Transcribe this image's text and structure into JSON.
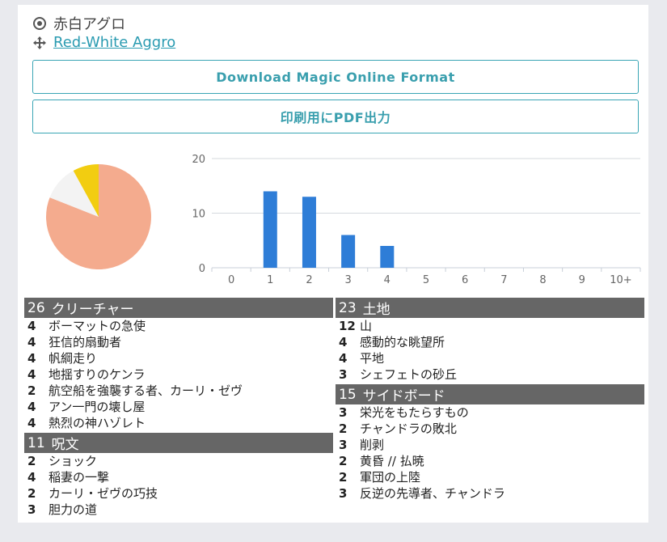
{
  "deck": {
    "name_jp": "赤白アグロ",
    "name_en": "Red-White Aggro"
  },
  "buttons": {
    "mtgo": "Download Magic Online Format",
    "pdf": "印刷用にPDF出力"
  },
  "colors": {
    "accent": "#3aa5b5",
    "bar": "#2e7dd7",
    "header_bg": "#666666",
    "pie_red": "#f4ab8e",
    "pie_white": "#f3f3f3",
    "pie_yellow": "#f2cd11"
  },
  "chart_data": [
    {
      "type": "pie",
      "slices": [
        {
          "name": "red",
          "value": 0.81,
          "color": "#f4ab8e"
        },
        {
          "name": "white",
          "value": 0.11,
          "color": "#f3f3f3"
        },
        {
          "name": "yellow",
          "value": 0.08,
          "color": "#f2cd11"
        }
      ]
    },
    {
      "type": "bar",
      "categories": [
        "0",
        "1",
        "2",
        "3",
        "4",
        "5",
        "6",
        "7",
        "8",
        "9",
        "10+"
      ],
      "values": [
        0,
        14,
        13,
        6,
        4,
        0,
        0,
        0,
        0,
        0,
        0
      ],
      "ylim": [
        0,
        20
      ],
      "yticks": [
        "0",
        "10",
        "20"
      ],
      "grid": true
    }
  ],
  "sections": {
    "creatures": {
      "count": "26",
      "title": "クリーチャー",
      "cards": [
        {
          "qty": "4",
          "name": "ボーマットの急使"
        },
        {
          "qty": "4",
          "name": "狂信的扇動者"
        },
        {
          "qty": "4",
          "name": "帆綱走り"
        },
        {
          "qty": "4",
          "name": "地揺すりのケンラ"
        },
        {
          "qty": "2",
          "name": "航空船を強襲する者、カーリ・ゼヴ"
        },
        {
          "qty": "4",
          "name": "アン一門の壊し屋"
        },
        {
          "qty": "4",
          "name": "熱烈の神ハゾレト"
        }
      ]
    },
    "spells": {
      "count": "11",
      "title": "呪文",
      "cards": [
        {
          "qty": "2",
          "name": "ショック"
        },
        {
          "qty": "4",
          "name": "稲妻の一撃"
        },
        {
          "qty": "2",
          "name": "カーリ・ゼヴの巧技"
        },
        {
          "qty": "3",
          "name": "胆力の道"
        }
      ]
    },
    "lands": {
      "count": "23",
      "title": "土地",
      "cards": [
        {
          "qty": "12",
          "name": "山"
        },
        {
          "qty": "4",
          "name": "感動的な眺望所"
        },
        {
          "qty": "4",
          "name": "平地"
        },
        {
          "qty": "3",
          "name": "シェフェトの砂丘"
        }
      ]
    },
    "sideboard": {
      "count": "15",
      "title": "サイドボード",
      "cards": [
        {
          "qty": "3",
          "name": "栄光をもたらすもの"
        },
        {
          "qty": "2",
          "name": "チャンドラの敗北"
        },
        {
          "qty": "3",
          "name": "削剥"
        },
        {
          "qty": "2",
          "name": "黄昏 // 払暁"
        },
        {
          "qty": "2",
          "name": "軍団の上陸"
        },
        {
          "qty": "3",
          "name": "反逆の先導者、チャンドラ"
        }
      ]
    }
  }
}
